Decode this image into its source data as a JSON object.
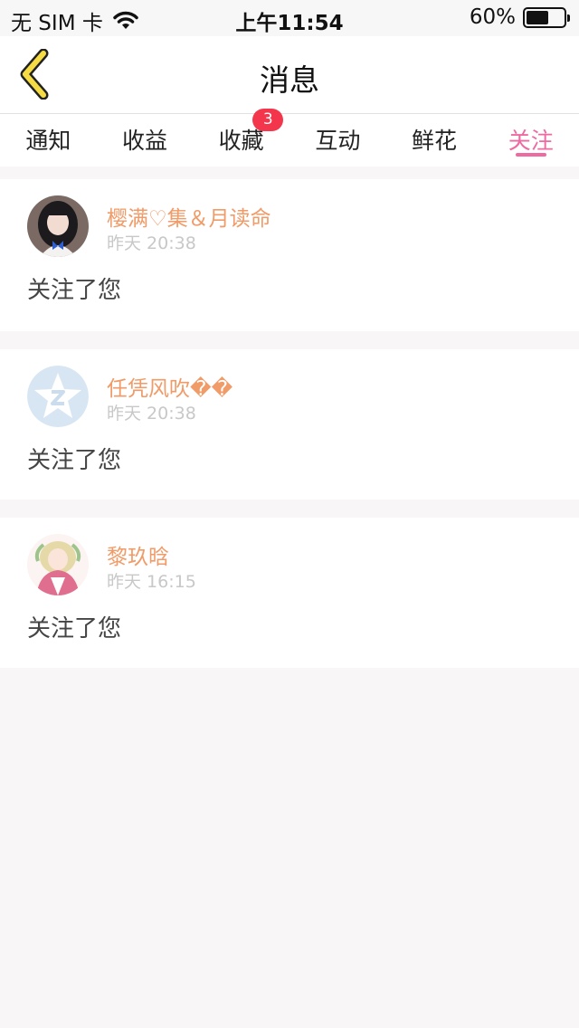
{
  "status_bar": {
    "carrier": "无 SIM 卡",
    "time": "上午11:54",
    "battery_percent": "60%",
    "battery_level": 0.6
  },
  "nav": {
    "title": "消息"
  },
  "tabs": [
    {
      "label": "通知"
    },
    {
      "label": "收益"
    },
    {
      "label": "收藏",
      "badge": "3"
    },
    {
      "label": "互动"
    },
    {
      "label": "鲜花"
    },
    {
      "label": "关注"
    }
  ],
  "active_tab": "关注",
  "messages": [
    {
      "name": "樱满♡集＆月读命",
      "time": "昨天 20:38",
      "action": "关注了您"
    },
    {
      "name": "任凭风吹��",
      "time": "昨天 20:38",
      "action": "关注了您"
    },
    {
      "name": "黎玖晗",
      "time": "昨天 16:15",
      "action": "关注了您"
    }
  ],
  "colors": {
    "accent_pink": "#ee6aa1",
    "username_orange": "#f09b68",
    "badge_red": "#f4364c",
    "back_arrow_yellow": "#f5dc45"
  }
}
